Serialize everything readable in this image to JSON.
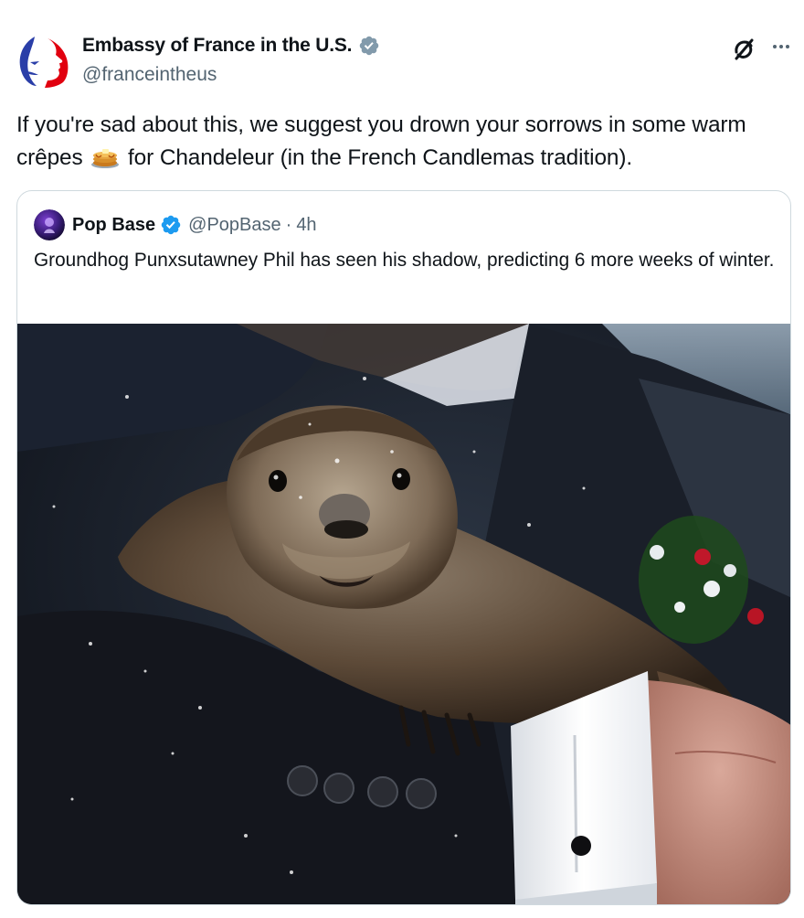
{
  "tweet": {
    "display_name": "Embassy of France in the U.S.",
    "handle": "@franceintheus",
    "avatar_icon": "marianne-logo-icon",
    "verified_icon": "verified-grey-badge-icon",
    "text_before_emoji": "If you're sad about this, we suggest you drown your sorrows in some warm crêpes ",
    "emoji_icon": "pancakes-icon",
    "text_after_emoji": " for Chandeleur (in the French Candlemas tradition).",
    "grok_icon": "grok-icon",
    "more_icon": "more-icon"
  },
  "quote": {
    "display_name": "Pop Base",
    "verified_icon": "verified-blue-badge-icon",
    "handle": "@PopBase",
    "separator": "·",
    "time": "4h",
    "text": "Groundhog Punxsutawney Phil has seen his shadow, predicting 6 more weeks of winter.",
    "image_subject": "groundhog-photo"
  },
  "colors": {
    "text": "#0f1419",
    "secondary": "#536471",
    "border": "#cfd9de",
    "blue_badge": "#1d9bf0",
    "grey_badge": "#829aab",
    "france_blue": "#2a3ea8",
    "france_red": "#e1000f"
  }
}
